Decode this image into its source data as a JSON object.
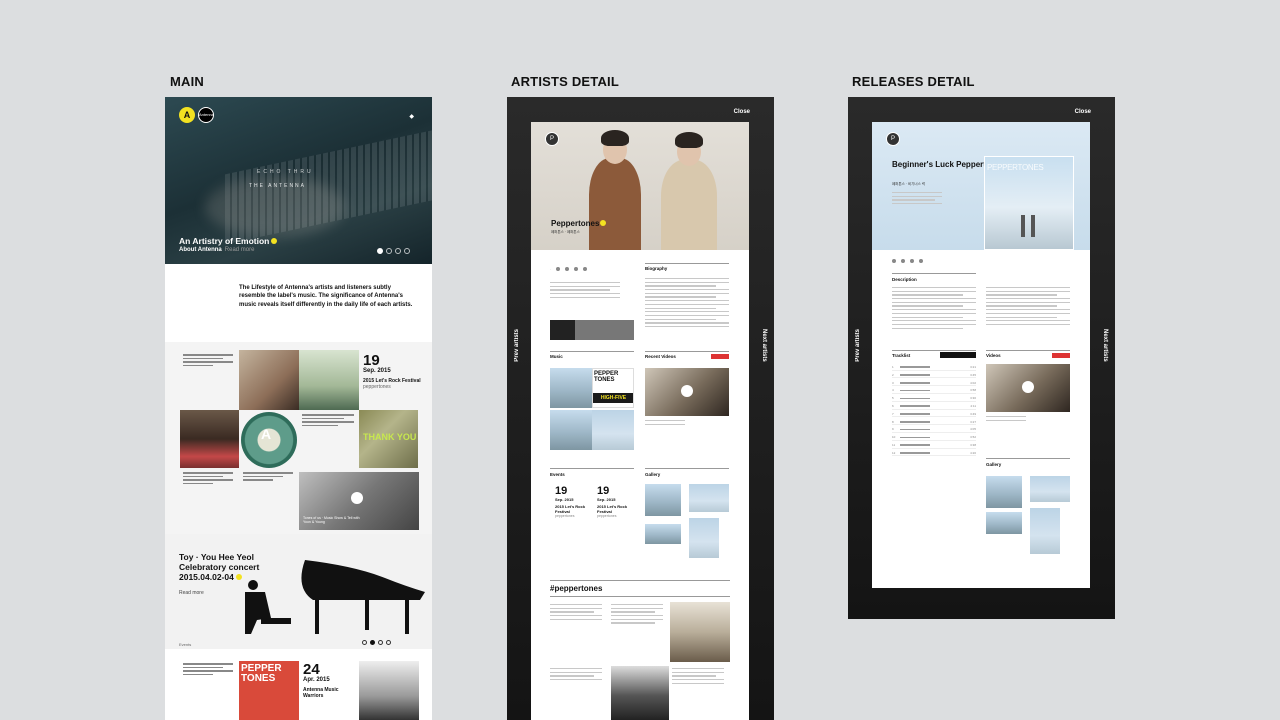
{
  "labels": {
    "main": "MAIN",
    "artists": "ARTISTS DETAIL",
    "releases": "RELEASES DETAIL"
  },
  "main": {
    "logo_letter": "A",
    "logo_wordmark": "Antenna",
    "hero": {
      "echo_text": "ECHO THRU",
      "antenna_text": "THE ANTENNA",
      "title": "An Artistry of Emotion",
      "sub": "About Antenna",
      "read_more": "Read more"
    },
    "intro": "The Lifestyle of Antenna's artists and listeners subtly resemble the label's music. The significance of Antenna's music reveals itself differently in the daily life of each artists.",
    "event_tile": {
      "day": "19",
      "month": "Sep. 2015",
      "title": "2015 Let's Rock Festival",
      "artist": "peppertones"
    },
    "thank_you": "THANK YOU",
    "video_tile": "Tones of us · Music Show & Tell with Yoon & Young",
    "concert": {
      "title": "Toy · You Hee Yeol Celebratory concert 2015.04.02-04",
      "read_more": "Read more",
      "category": "Events"
    },
    "bottom_tile": {
      "cover": "PEPPER TONES",
      "day": "24",
      "month": "Apr. 2015",
      "title": "Antenna Music Warriors"
    }
  },
  "artists": {
    "close": "Close",
    "prev": "Prev artists",
    "next": "Next artists",
    "name": "Peppertones",
    "sub": "페퍼톤스 · 페퍼톤스",
    "sections": {
      "biography": "Biography",
      "music": "Music",
      "recent_videos": "Recent Videos",
      "events": "Events",
      "gallery": "Gallery",
      "hashtag": "#peppertones"
    },
    "album_text": "PEPPER TONES",
    "album_text2": "HIGH-FIVE",
    "events": [
      {
        "day": "19",
        "month": "Sep. 2015",
        "title": "2015 Let's Rock Festival",
        "artist": "peppertones"
      },
      {
        "day": "19",
        "month": "Sep. 2015",
        "title": "2015 Let's Rock Festival",
        "artist": "peppertones"
      }
    ]
  },
  "releases": {
    "close": "Close",
    "prev": "Prev artists",
    "next": "Next artists",
    "title": "Beginner's Luck Peppertones",
    "sub": "페퍼톤스 · 비기너스 럭",
    "cover_brand": "PEPPERTONES",
    "sections": {
      "description": "Description",
      "tracklist": "Tracklist",
      "videos": "Videos",
      "gallery": "Gallery"
    },
    "tracks": [
      {
        "n": "1",
        "t": "3:21"
      },
      {
        "n": "2",
        "t": "3:45"
      },
      {
        "n": "3",
        "t": "4:02"
      },
      {
        "n": "4",
        "t": "3:58"
      },
      {
        "n": "5",
        "t": "3:30"
      },
      {
        "n": "6",
        "t": "4:11"
      },
      {
        "n": "7",
        "t": "3:49"
      },
      {
        "n": "8",
        "t": "3:27"
      },
      {
        "n": "9",
        "t": "4:05"
      },
      {
        "n": "10",
        "t": "3:52"
      },
      {
        "n": "11",
        "t": "3:38"
      },
      {
        "n": "12",
        "t": "4:20"
      }
    ]
  }
}
